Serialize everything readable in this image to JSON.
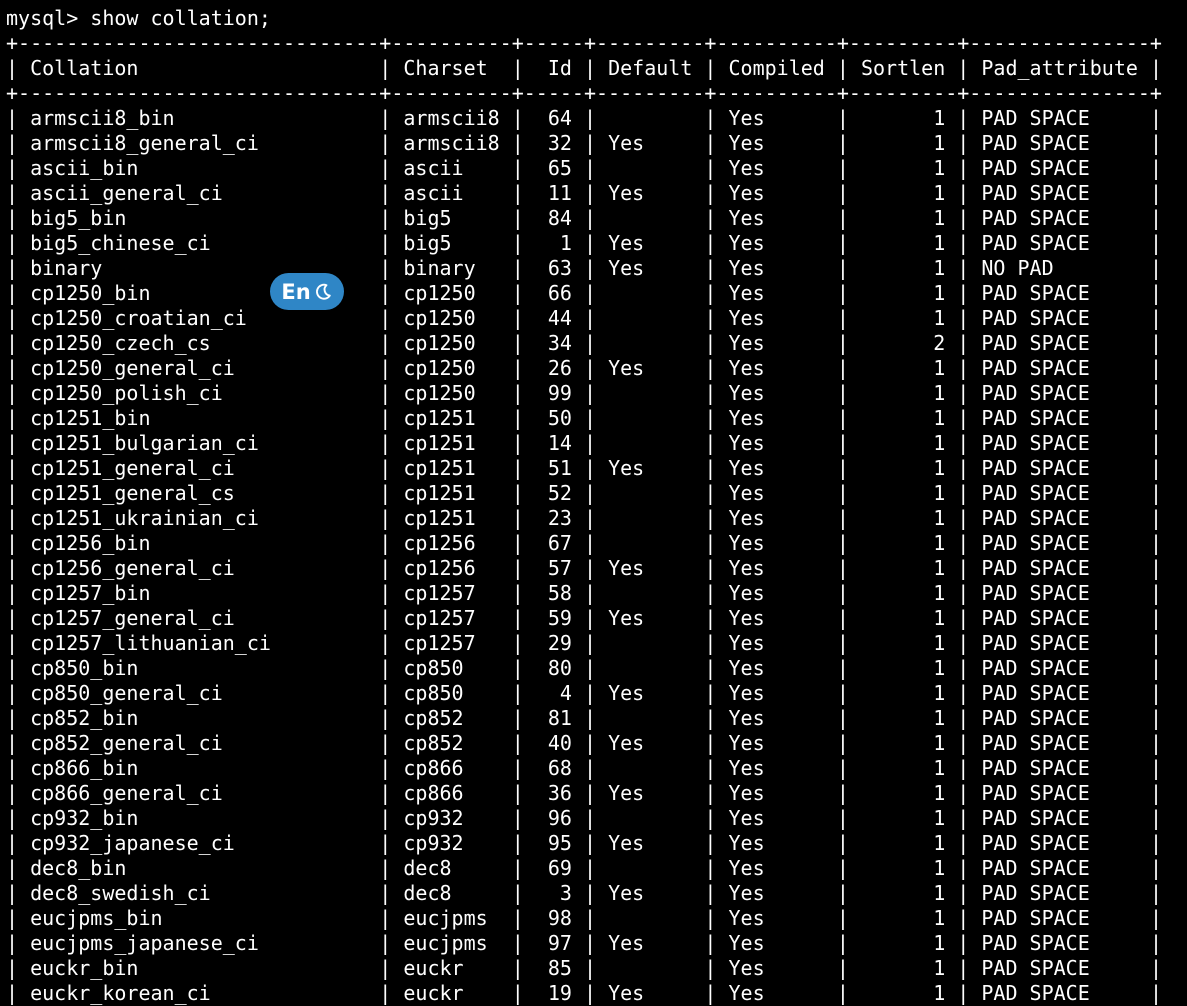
{
  "prompt": "mysql>",
  "command": "show collation;",
  "columns": [
    {
      "key": "collation",
      "label": "Collation",
      "width": 28,
      "align": "left"
    },
    {
      "key": "charset",
      "label": "Charset",
      "width": 8,
      "align": "left"
    },
    {
      "key": "id",
      "label": "Id",
      "width": 3,
      "align": "right"
    },
    {
      "key": "default",
      "label": "Default",
      "width": 7,
      "align": "left"
    },
    {
      "key": "compiled",
      "label": "Compiled",
      "width": 8,
      "align": "left"
    },
    {
      "key": "sortlen",
      "label": "Sortlen",
      "width": 7,
      "align": "right"
    },
    {
      "key": "pad_attribute",
      "label": "Pad_attribute",
      "width": 13,
      "align": "left"
    }
  ],
  "rows": [
    {
      "collation": "armscii8_bin",
      "charset": "armscii8",
      "id": "64",
      "default": "",
      "compiled": "Yes",
      "sortlen": "1",
      "pad_attribute": "PAD SPACE"
    },
    {
      "collation": "armscii8_general_ci",
      "charset": "armscii8",
      "id": "32",
      "default": "Yes",
      "compiled": "Yes",
      "sortlen": "1",
      "pad_attribute": "PAD SPACE"
    },
    {
      "collation": "ascii_bin",
      "charset": "ascii",
      "id": "65",
      "default": "",
      "compiled": "Yes",
      "sortlen": "1",
      "pad_attribute": "PAD SPACE"
    },
    {
      "collation": "ascii_general_ci",
      "charset": "ascii",
      "id": "11",
      "default": "Yes",
      "compiled": "Yes",
      "sortlen": "1",
      "pad_attribute": "PAD SPACE"
    },
    {
      "collation": "big5_bin",
      "charset": "big5",
      "id": "84",
      "default": "",
      "compiled": "Yes",
      "sortlen": "1",
      "pad_attribute": "PAD SPACE"
    },
    {
      "collation": "big5_chinese_ci",
      "charset": "big5",
      "id": "1",
      "default": "Yes",
      "compiled": "Yes",
      "sortlen": "1",
      "pad_attribute": "PAD SPACE"
    },
    {
      "collation": "binary",
      "charset": "binary",
      "id": "63",
      "default": "Yes",
      "compiled": "Yes",
      "sortlen": "1",
      "pad_attribute": "NO PAD"
    },
    {
      "collation": "cp1250_bin",
      "charset": "cp1250",
      "id": "66",
      "default": "",
      "compiled": "Yes",
      "sortlen": "1",
      "pad_attribute": "PAD SPACE"
    },
    {
      "collation": "cp1250_croatian_ci",
      "charset": "cp1250",
      "id": "44",
      "default": "",
      "compiled": "Yes",
      "sortlen": "1",
      "pad_attribute": "PAD SPACE"
    },
    {
      "collation": "cp1250_czech_cs",
      "charset": "cp1250",
      "id": "34",
      "default": "",
      "compiled": "Yes",
      "sortlen": "2",
      "pad_attribute": "PAD SPACE"
    },
    {
      "collation": "cp1250_general_ci",
      "charset": "cp1250",
      "id": "26",
      "default": "Yes",
      "compiled": "Yes",
      "sortlen": "1",
      "pad_attribute": "PAD SPACE"
    },
    {
      "collation": "cp1250_polish_ci",
      "charset": "cp1250",
      "id": "99",
      "default": "",
      "compiled": "Yes",
      "sortlen": "1",
      "pad_attribute": "PAD SPACE"
    },
    {
      "collation": "cp1251_bin",
      "charset": "cp1251",
      "id": "50",
      "default": "",
      "compiled": "Yes",
      "sortlen": "1",
      "pad_attribute": "PAD SPACE"
    },
    {
      "collation": "cp1251_bulgarian_ci",
      "charset": "cp1251",
      "id": "14",
      "default": "",
      "compiled": "Yes",
      "sortlen": "1",
      "pad_attribute": "PAD SPACE"
    },
    {
      "collation": "cp1251_general_ci",
      "charset": "cp1251",
      "id": "51",
      "default": "Yes",
      "compiled": "Yes",
      "sortlen": "1",
      "pad_attribute": "PAD SPACE"
    },
    {
      "collation": "cp1251_general_cs",
      "charset": "cp1251",
      "id": "52",
      "default": "",
      "compiled": "Yes",
      "sortlen": "1",
      "pad_attribute": "PAD SPACE"
    },
    {
      "collation": "cp1251_ukrainian_ci",
      "charset": "cp1251",
      "id": "23",
      "default": "",
      "compiled": "Yes",
      "sortlen": "1",
      "pad_attribute": "PAD SPACE"
    },
    {
      "collation": "cp1256_bin",
      "charset": "cp1256",
      "id": "67",
      "default": "",
      "compiled": "Yes",
      "sortlen": "1",
      "pad_attribute": "PAD SPACE"
    },
    {
      "collation": "cp1256_general_ci",
      "charset": "cp1256",
      "id": "57",
      "default": "Yes",
      "compiled": "Yes",
      "sortlen": "1",
      "pad_attribute": "PAD SPACE"
    },
    {
      "collation": "cp1257_bin",
      "charset": "cp1257",
      "id": "58",
      "default": "",
      "compiled": "Yes",
      "sortlen": "1",
      "pad_attribute": "PAD SPACE"
    },
    {
      "collation": "cp1257_general_ci",
      "charset": "cp1257",
      "id": "59",
      "default": "Yes",
      "compiled": "Yes",
      "sortlen": "1",
      "pad_attribute": "PAD SPACE"
    },
    {
      "collation": "cp1257_lithuanian_ci",
      "charset": "cp1257",
      "id": "29",
      "default": "",
      "compiled": "Yes",
      "sortlen": "1",
      "pad_attribute": "PAD SPACE"
    },
    {
      "collation": "cp850_bin",
      "charset": "cp850",
      "id": "80",
      "default": "",
      "compiled": "Yes",
      "sortlen": "1",
      "pad_attribute": "PAD SPACE"
    },
    {
      "collation": "cp850_general_ci",
      "charset": "cp850",
      "id": "4",
      "default": "Yes",
      "compiled": "Yes",
      "sortlen": "1",
      "pad_attribute": "PAD SPACE"
    },
    {
      "collation": "cp852_bin",
      "charset": "cp852",
      "id": "81",
      "default": "",
      "compiled": "Yes",
      "sortlen": "1",
      "pad_attribute": "PAD SPACE"
    },
    {
      "collation": "cp852_general_ci",
      "charset": "cp852",
      "id": "40",
      "default": "Yes",
      "compiled": "Yes",
      "sortlen": "1",
      "pad_attribute": "PAD SPACE"
    },
    {
      "collation": "cp866_bin",
      "charset": "cp866",
      "id": "68",
      "default": "",
      "compiled": "Yes",
      "sortlen": "1",
      "pad_attribute": "PAD SPACE"
    },
    {
      "collation": "cp866_general_ci",
      "charset": "cp866",
      "id": "36",
      "default": "Yes",
      "compiled": "Yes",
      "sortlen": "1",
      "pad_attribute": "PAD SPACE"
    },
    {
      "collation": "cp932_bin",
      "charset": "cp932",
      "id": "96",
      "default": "",
      "compiled": "Yes",
      "sortlen": "1",
      "pad_attribute": "PAD SPACE"
    },
    {
      "collation": "cp932_japanese_ci",
      "charset": "cp932",
      "id": "95",
      "default": "Yes",
      "compiled": "Yes",
      "sortlen": "1",
      "pad_attribute": "PAD SPACE"
    },
    {
      "collation": "dec8_bin",
      "charset": "dec8",
      "id": "69",
      "default": "",
      "compiled": "Yes",
      "sortlen": "1",
      "pad_attribute": "PAD SPACE"
    },
    {
      "collation": "dec8_swedish_ci",
      "charset": "dec8",
      "id": "3",
      "default": "Yes",
      "compiled": "Yes",
      "sortlen": "1",
      "pad_attribute": "PAD SPACE"
    },
    {
      "collation": "eucjpms_bin",
      "charset": "eucjpms",
      "id": "98",
      "default": "",
      "compiled": "Yes",
      "sortlen": "1",
      "pad_attribute": "PAD SPACE"
    },
    {
      "collation": "eucjpms_japanese_ci",
      "charset": "eucjpms",
      "id": "97",
      "default": "Yes",
      "compiled": "Yes",
      "sortlen": "1",
      "pad_attribute": "PAD SPACE"
    },
    {
      "collation": "euckr_bin",
      "charset": "euckr",
      "id": "85",
      "default": "",
      "compiled": "Yes",
      "sortlen": "1",
      "pad_attribute": "PAD SPACE"
    },
    {
      "collation": "euckr_korean_ci",
      "charset": "euckr",
      "id": "19",
      "default": "Yes",
      "compiled": "Yes",
      "sortlen": "1",
      "pad_attribute": "PAD SPACE"
    }
  ],
  "ime_indicator": {
    "label": "En",
    "icon": "moon-icon",
    "color": "#2f86c6"
  },
  "colors": {
    "background": "#000000",
    "text": "#ffffff"
  }
}
